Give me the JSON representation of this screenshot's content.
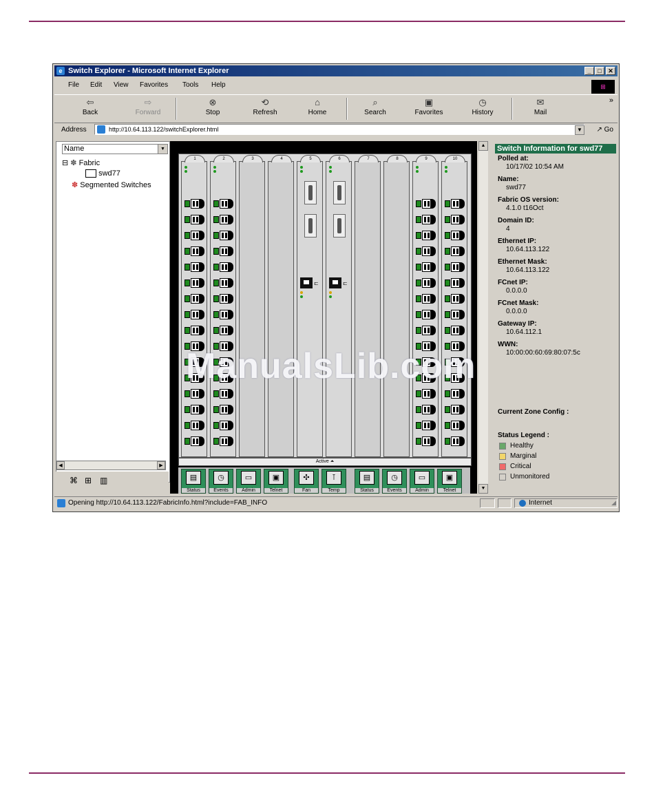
{
  "window": {
    "title": "Switch Explorer - Microsoft Internet Explorer",
    "controls": [
      "_",
      "□",
      "✕"
    ]
  },
  "menu": [
    "File",
    "Edit",
    "View",
    "Favorites",
    "Tools",
    "Help"
  ],
  "toolbar": {
    "buttons": [
      {
        "label": "Back",
        "icon": "back-arrow-icon",
        "enabled": true
      },
      {
        "label": "Forward",
        "icon": "forward-arrow-icon",
        "enabled": false
      },
      {
        "label": "Stop",
        "icon": "stop-icon",
        "enabled": true
      },
      {
        "label": "Refresh",
        "icon": "refresh-icon",
        "enabled": true
      },
      {
        "label": "Home",
        "icon": "home-icon",
        "enabled": true
      },
      {
        "label": "Search",
        "icon": "search-icon",
        "enabled": true
      },
      {
        "label": "Favorites",
        "icon": "favorites-icon",
        "enabled": true
      },
      {
        "label": "History",
        "icon": "history-icon",
        "enabled": true
      },
      {
        "label": "Mail",
        "icon": "mail-icon",
        "enabled": true
      }
    ],
    "more": "»"
  },
  "address": {
    "label": "Address",
    "url": "http://10.64.113.122/switchExplorer.html",
    "go_label": "Go"
  },
  "left_pane": {
    "sort_field": "Name",
    "tree": {
      "root": "Fabric",
      "switch": "swd77",
      "segmented": "Segmented Switches"
    }
  },
  "switch_view": {
    "slots": [
      {
        "num": "1",
        "kind": "port-card"
      },
      {
        "num": "2",
        "kind": "port-card"
      },
      {
        "num": "3",
        "kind": "empty"
      },
      {
        "num": "4",
        "kind": "empty"
      },
      {
        "num": "5",
        "kind": "cp-card"
      },
      {
        "num": "6",
        "kind": "cp-card"
      },
      {
        "num": "7",
        "kind": "empty"
      },
      {
        "num": "8",
        "kind": "empty"
      },
      {
        "num": "9",
        "kind": "port-card"
      },
      {
        "num": "10",
        "kind": "port-card"
      }
    ],
    "active_label": "Active ⏶",
    "buttons_left": [
      "Status",
      "Events",
      "Admin",
      "Telnet"
    ],
    "buttons_center": [
      "Fan",
      "Temp"
    ],
    "buttons_right": [
      "Status",
      "Events",
      "Admin",
      "Telnet"
    ]
  },
  "info": {
    "heading": "Switch Information for swd77",
    "fields": [
      {
        "label": "Polled at:",
        "value": "10/17/02 10:54 AM"
      },
      {
        "label": "Name:",
        "value": "swd77"
      },
      {
        "label": "Fabric OS version:",
        "value": "4.1.0 t16Oct"
      },
      {
        "label": "Domain ID:",
        "value": "4"
      },
      {
        "label": "Ethernet IP:",
        "value": "10.64.113.122"
      },
      {
        "label": "Ethernet Mask:",
        "value": "10.64.113.122"
      },
      {
        "label": "FCnet IP:",
        "value": "0.0.0.0"
      },
      {
        "label": "FCnet Mask:",
        "value": "0.0.0.0"
      },
      {
        "label": "Gateway IP:",
        "value": "10.64.112.1"
      },
      {
        "label": "WWN:",
        "value": "10:00:00:60:69:80:07:5c"
      }
    ],
    "zone_label": "Current Zone Config :",
    "legend_title": "Status Legend :",
    "legend": [
      {
        "label": "Healthy",
        "color": "#6aa86a"
      },
      {
        "label": "Marginal",
        "color": "#f2d66a"
      },
      {
        "label": "Critical",
        "color": "#f06a6a"
      },
      {
        "label": "Unmonitored",
        "color": "#d4d0c8"
      }
    ]
  },
  "status_bar": {
    "message": "Opening http://10.64.113.122/FabricInfo.html?include=FAB_INFO",
    "zone": "Internet"
  },
  "watermark": "ManualsLib.com",
  "colors": {
    "rule": "#8a2a64",
    "title_bar": "#0a246a",
    "info_header": "#1f6e4a",
    "port_sfp": "#1f8a1f"
  }
}
